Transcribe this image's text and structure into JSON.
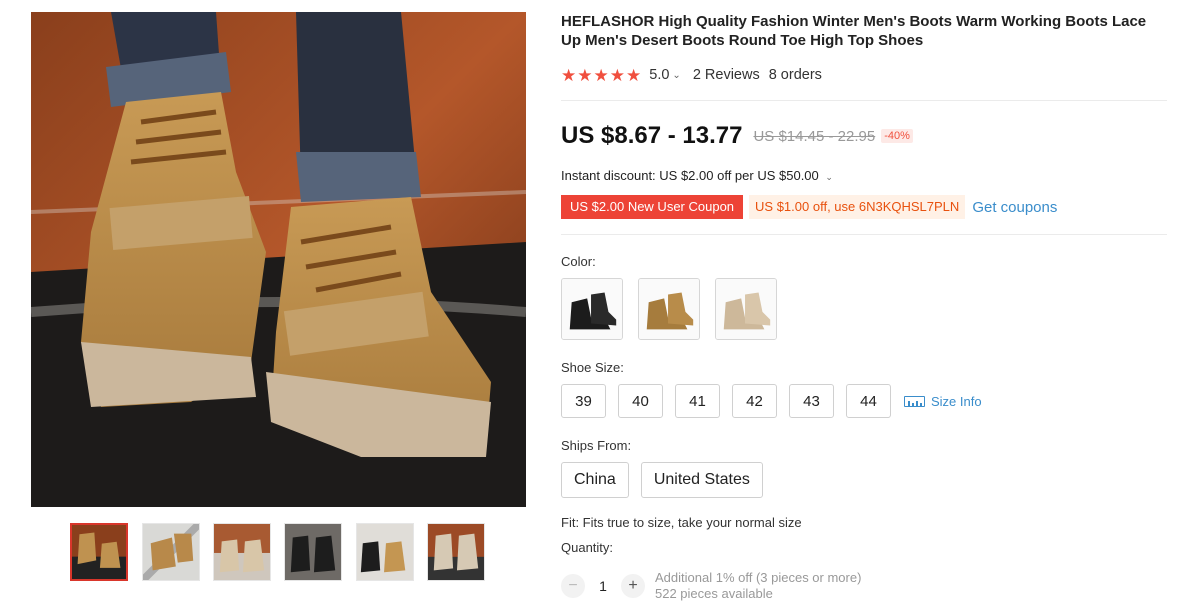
{
  "product": {
    "title": "HEFLASHOR High Quality Fashion Winter Men's Boots Warm Working Boots Lace Up Men's Desert Boots Round Toe High Top Shoes",
    "rating": {
      "stars": 5,
      "score": "5.0",
      "reviews": "2 Reviews",
      "orders": "8 orders"
    },
    "price": {
      "current": "US $8.67 - 13.77",
      "original": "US $14.45 - 22.95",
      "discount_badge": "-40%"
    },
    "instant_discount": "Instant discount: US $2.00 off per US $50.00",
    "coupons": {
      "new_user": "US $2.00 New User Coupon",
      "code": "US $1.00 off, use 6N3KQHSL7PLN",
      "get_coupons": "Get coupons"
    },
    "color": {
      "label": "Color:",
      "options": [
        {
          "name": "black-boots-swatch",
          "shade": "#1c1c1c"
        },
        {
          "name": "khaki-boots-swatch",
          "shade": "#a67c3d"
        },
        {
          "name": "beige-boots-swatch",
          "shade": "#cdb89a"
        }
      ]
    },
    "size": {
      "label": "Shoe Size:",
      "options": [
        "39",
        "40",
        "41",
        "42",
        "43",
        "44"
      ],
      "size_info": "Size Info",
      "size_info_icon": "ruler-icon"
    },
    "ships_from": {
      "label": "Ships From:",
      "options": [
        "China",
        "United States"
      ]
    },
    "fit": "Fit: Fits true to size, take your normal size",
    "quantity": {
      "label": "Quantity:",
      "value": "1",
      "minus": "−",
      "plus": "+",
      "note": "Additional 1% off (3 pieces or more)",
      "available": "522 pieces available"
    }
  },
  "gallery": {
    "thumbnail_count": 6,
    "active_index": 0
  },
  "colors": {
    "accent_red": "#f04f3e",
    "coupon_red": "#ed4336",
    "coupon_orange": "#e8510e",
    "link_blue": "#3a8dcb"
  }
}
